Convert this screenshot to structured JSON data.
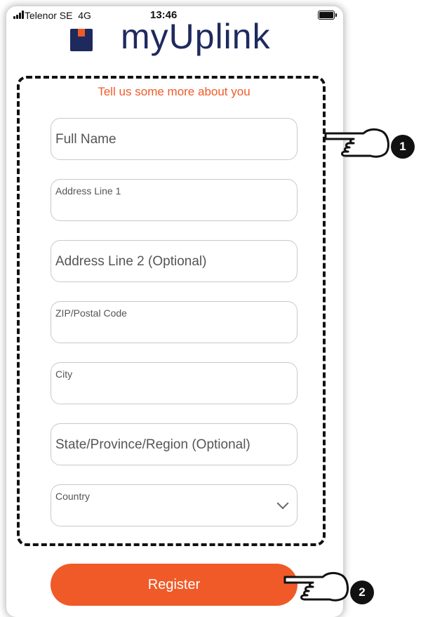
{
  "status_bar": {
    "carrier": "Telenor SE",
    "network": "4G",
    "time": "13:46"
  },
  "app": {
    "logo_text": "myUplink",
    "subtitle": "Tell us some more about you"
  },
  "form": {
    "full_name_placeholder": "Full Name",
    "address1_label": "Address Line 1",
    "address2_placeholder": "Address Line 2 (Optional)",
    "zip_label": "ZIP/Postal Code",
    "city_label": "City",
    "state_placeholder": "State/Province/Region (Optional)",
    "country_label": "Country"
  },
  "actions": {
    "register_label": "Register"
  },
  "annotations": {
    "marker_1": "1",
    "marker_2": "2"
  },
  "colors": {
    "accent": "#f05a28",
    "brand": "#1e2a5e"
  }
}
